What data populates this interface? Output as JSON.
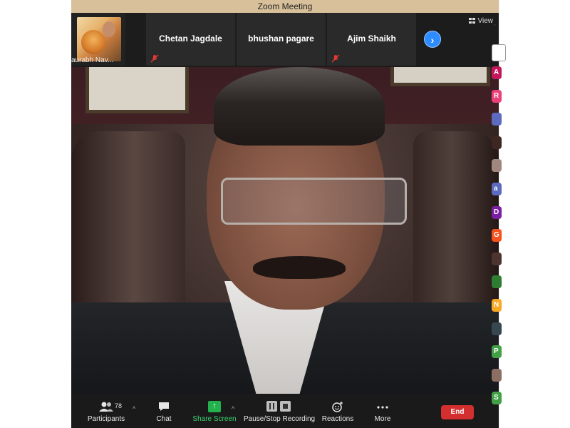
{
  "window": {
    "title": "Zoom Meeting"
  },
  "thumbnails": {
    "self_name": "aurabh Nav...",
    "participants": [
      {
        "name": "Chetan Jagdale",
        "muted": true
      },
      {
        "name": "bhushan pagare",
        "muted": false
      },
      {
        "name": "Ajim Shaikh",
        "muted": true
      }
    ],
    "view_label": "View"
  },
  "toolbar": {
    "participants_label": "Participants",
    "participants_count": "78",
    "chat_label": "Chat",
    "share_label": "Share Screen",
    "recording_label": "Pause/Stop Recording",
    "reactions_label": "Reactions",
    "more_label": "More",
    "end_label": "End"
  },
  "side_list": {
    "avatars": [
      {
        "initial": "A",
        "color": "#c2185b"
      },
      {
        "initial": "R",
        "color": "#ec407a"
      },
      {
        "initial": "",
        "color": "#5c6bc0"
      },
      {
        "initial": "",
        "color": "#3e2723"
      },
      {
        "initial": "",
        "color": "#a1887f"
      },
      {
        "initial": "a",
        "color": "#5c6bc0"
      },
      {
        "initial": "D",
        "color": "#7b1fa2"
      },
      {
        "initial": "G",
        "color": "#f4511e"
      },
      {
        "initial": "",
        "color": "#4e342e"
      },
      {
        "initial": "",
        "color": "#2e7d32"
      },
      {
        "initial": "N",
        "color": "#f9a825"
      },
      {
        "initial": "",
        "color": "#37474f"
      },
      {
        "initial": "P",
        "color": "#43a047"
      },
      {
        "initial": "",
        "color": "#8d6e63"
      },
      {
        "initial": "S",
        "color": "#43a047"
      }
    ]
  },
  "colors": {
    "accent": "#2d8cff",
    "end": "#d32f2f",
    "share": "#23b14d"
  }
}
